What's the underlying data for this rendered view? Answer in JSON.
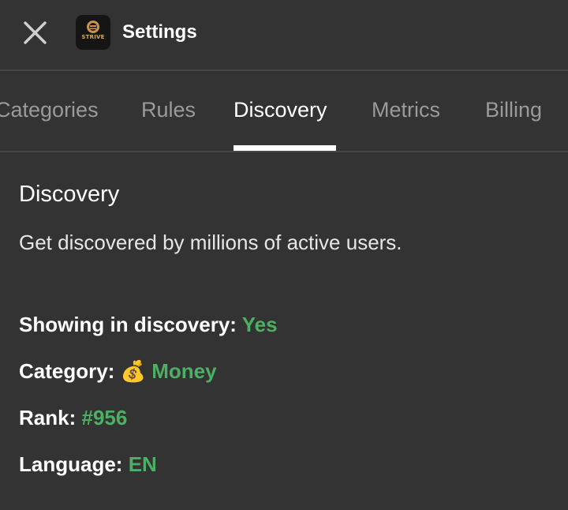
{
  "header": {
    "close_icon": "close-icon",
    "app_logo_text": "STRIVE",
    "title": "Settings"
  },
  "tabs": [
    {
      "label": "Categories",
      "active": false
    },
    {
      "label": "Rules",
      "active": false
    },
    {
      "label": "Discovery",
      "active": true
    },
    {
      "label": "Metrics",
      "active": false
    },
    {
      "label": "Billing",
      "active": false
    }
  ],
  "discovery": {
    "title": "Discovery",
    "description": "Get discovered by millions of active users.",
    "showing_label": "Showing in discovery:",
    "showing_value": "Yes",
    "category_label": "Category:",
    "category_icon": "money-bag-icon",
    "category_emoji": "💰",
    "category_value": "Money",
    "rank_label": "Rank:",
    "rank_value": "#956",
    "language_label": "Language:",
    "language_value": "EN"
  },
  "colors": {
    "background": "#333333",
    "accent_green": "#4caf63",
    "inactive_tab": "#9a9a9a"
  }
}
